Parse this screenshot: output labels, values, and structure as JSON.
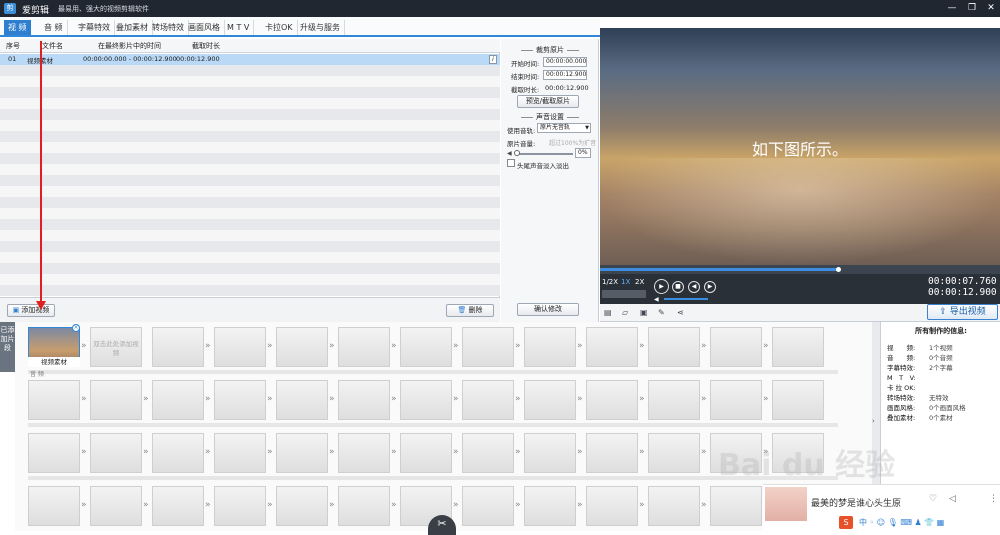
{
  "titlebar": {
    "app_name": "爱剪辑",
    "slogan": "最易用、强大的视频剪辑软件",
    "logo": "剪",
    "min": "—",
    "restore": "❐",
    "close": "✕"
  },
  "tabs": [
    "视 频",
    "音 频",
    "字幕特效",
    "叠加素材",
    "转场特效",
    "画面风格",
    "M T V",
    "卡拉OK",
    "升级与服务"
  ],
  "grid": {
    "headers": [
      "序号",
      "文件名",
      "在最终影片中的时间",
      "截取时长"
    ],
    "rows": [
      {
        "index": "01",
        "filename": "视频素材",
        "time": "00:00:00.000 - 00:00:12.900",
        "duration": "00:00:12.900",
        "info": "i"
      }
    ]
  },
  "bottombar": {
    "add_video": "添加视频",
    "delete": "删除",
    "confirm": "确认修改"
  },
  "clip_panel": {
    "section_clip": "裁剪原片",
    "start_label": "开始时间:",
    "start_value": "00:00:00.000",
    "end_label": "结束时间:",
    "end_value": "00:00:12.900",
    "length_label": "截取时长:",
    "length_value": "00:00:12.900",
    "preview_btn": "预览/截取原片",
    "section_audio": "声音设置",
    "track_label": "使用音轨:",
    "track_value": "原片无音轨",
    "volume_label": "原片音量:",
    "volume_hint": "超过100%为扩音",
    "volume_value": "0%",
    "fade_label": "头尾声音淡入淡出"
  },
  "preview": {
    "overlay_text": "如下图所示。"
  },
  "player": {
    "speeds": [
      "1/2X",
      "1X",
      "2X"
    ],
    "time_current": "00:00:07.760",
    "time_total": "00:00:12.900",
    "progress": 0.6
  },
  "export_label": "导出视频",
  "storyboard": {
    "side_label": "已添加片段",
    "first_clip": "视频素材",
    "placeholder": "双击此处添加视频",
    "audio_label": "音 频"
  },
  "info": {
    "title": "所有制作的信息:",
    "items": [
      {
        "k": "视　　频:",
        "v": "1个视频"
      },
      {
        "k": "音　　频:",
        "v": "0个音频"
      },
      {
        "k": "字幕特效:",
        "v": "2个字幕"
      },
      {
        "k": "M　T　V:",
        "v": ""
      },
      {
        "k": "卡 拉 OK:",
        "v": ""
      },
      {
        "k": "转场特效:",
        "v": "无特效"
      },
      {
        "k": "画面风格:",
        "v": "0个画面风格"
      },
      {
        "k": "叠加素材:",
        "v": "0个素材"
      }
    ]
  },
  "ad": {
    "text": "最美的梦是谁心头生原"
  },
  "watermark": "Bai du 经验",
  "colors": {
    "accent": "#2f7fd1",
    "titlebar": "#202730",
    "annotation": "#e02020"
  }
}
